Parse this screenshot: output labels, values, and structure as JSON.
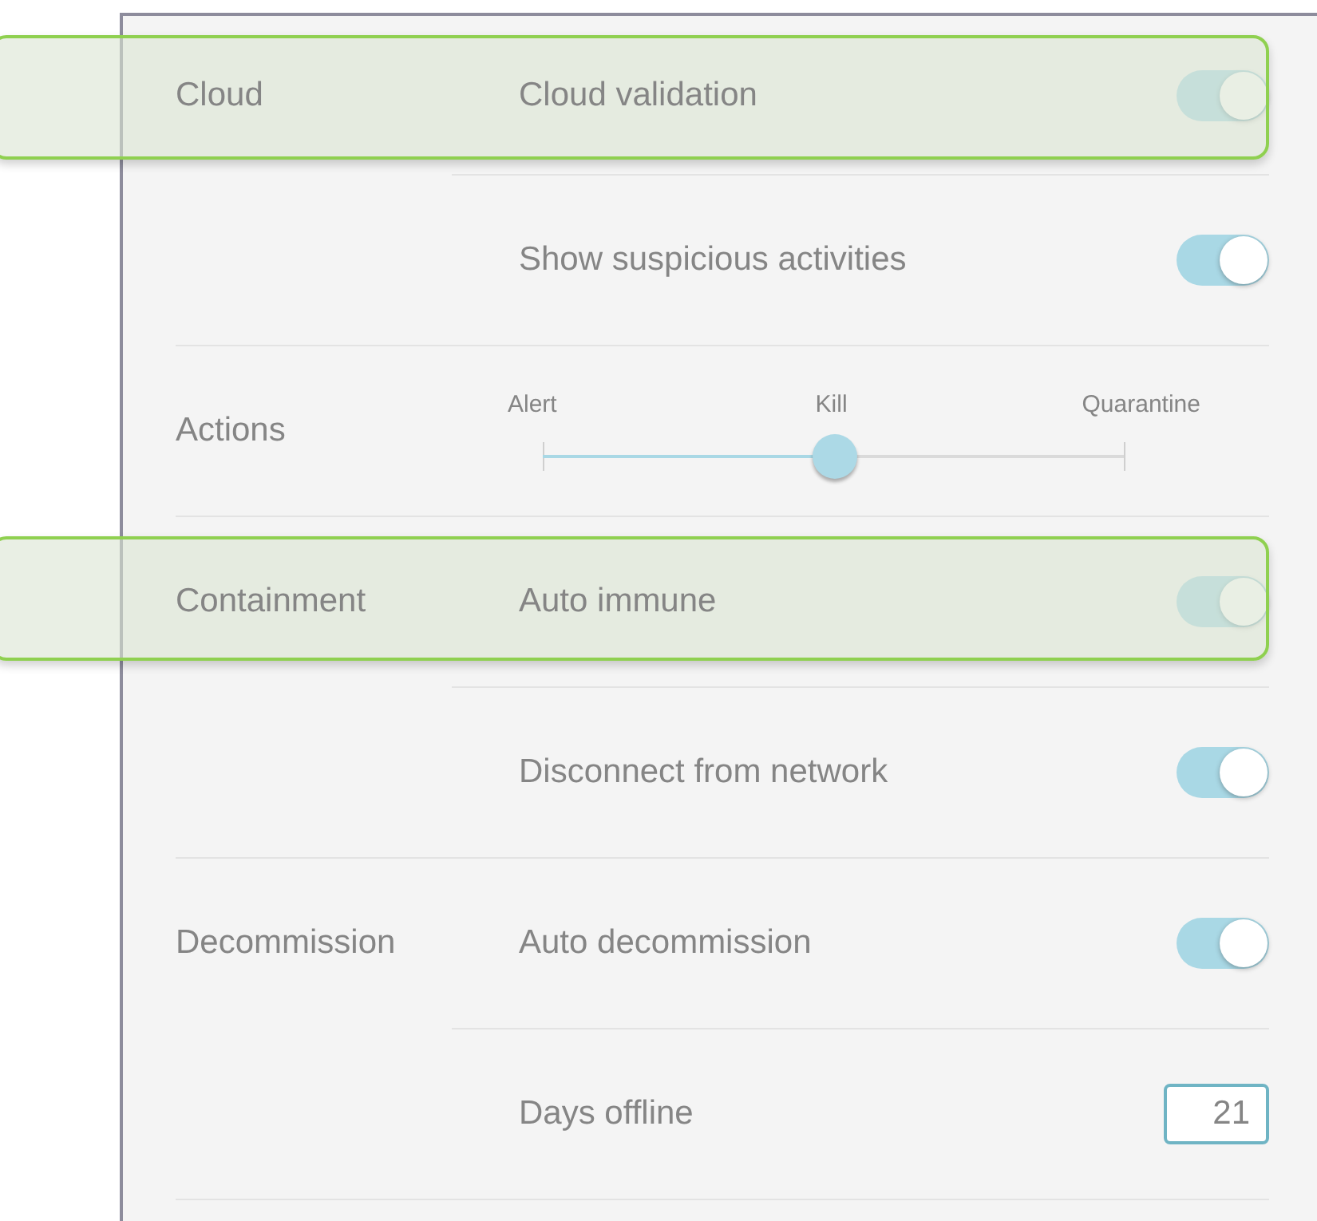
{
  "sections": [
    {
      "label": "Cloud",
      "items": [
        {
          "kind": "toggle",
          "label": "Cloud validation",
          "on": true,
          "highlighted": true
        },
        {
          "kind": "toggle",
          "label": "Show suspicious activities",
          "on": true,
          "highlighted": false
        }
      ]
    },
    {
      "label": "Actions",
      "items": [
        {
          "kind": "slider",
          "stops": [
            "Alert",
            "Kill",
            "Quarantine"
          ],
          "level": 0.5,
          "highlighted": false
        }
      ]
    },
    {
      "label": "Containment",
      "items": [
        {
          "kind": "toggle",
          "label": "Auto immune",
          "on": true,
          "highlighted": true
        },
        {
          "kind": "toggle",
          "label": "Disconnect from network",
          "on": true,
          "highlighted": false
        }
      ]
    },
    {
      "label": "Decommission",
      "items": [
        {
          "kind": "toggle",
          "label": "Auto decommission",
          "on": true,
          "highlighted": false
        },
        {
          "kind": "number",
          "label": "Days offline",
          "value": "21",
          "highlighted": false
        }
      ]
    }
  ]
}
